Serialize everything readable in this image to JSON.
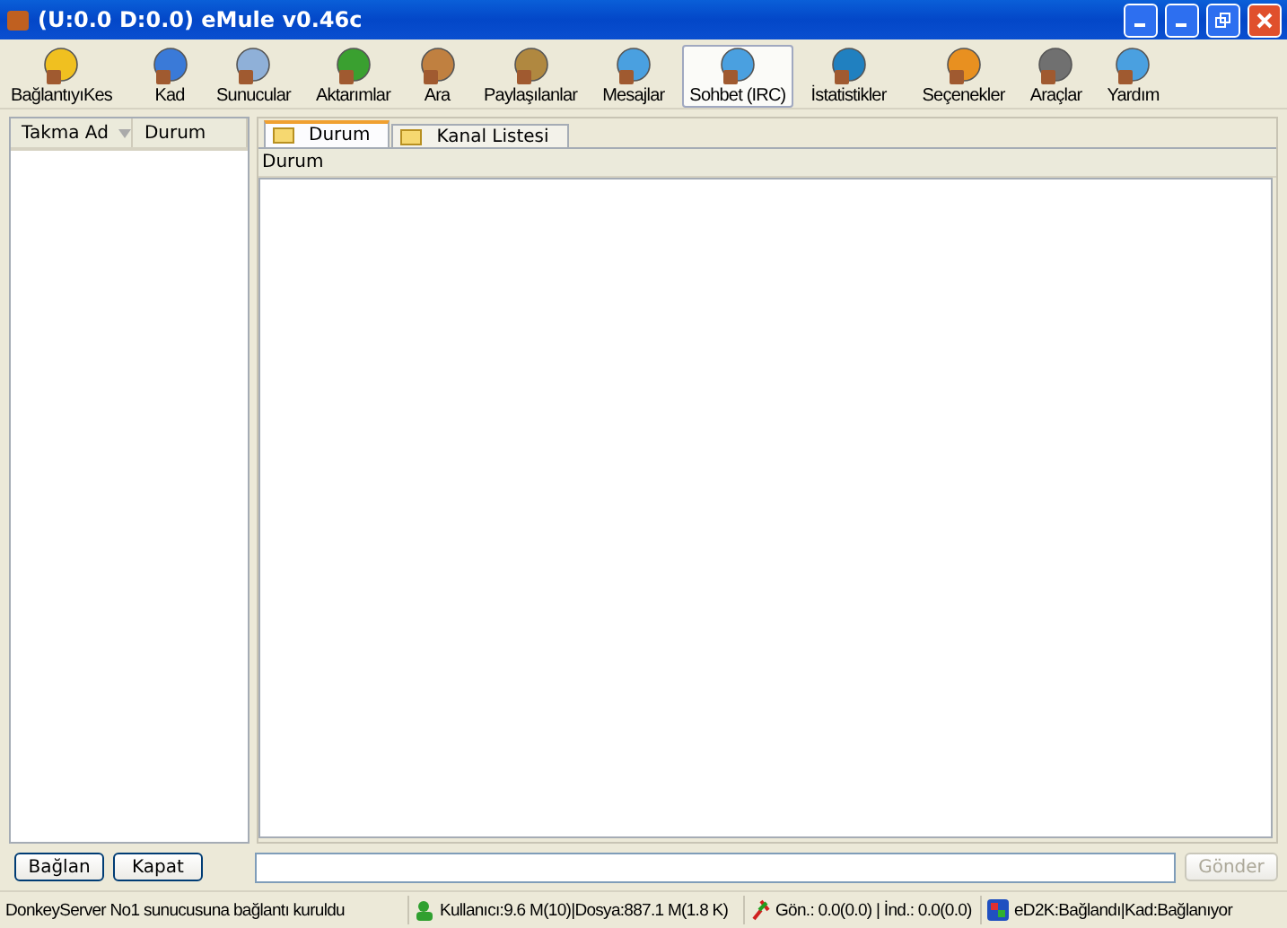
{
  "window": {
    "title": "(U:0.0 D:0.0) eMule v0.46c"
  },
  "toolbar": [
    {
      "label": "BağlantıyıKes",
      "selected": false
    },
    {
      "label": "Kad",
      "selected": false
    },
    {
      "label": "Sunucular",
      "selected": false
    },
    {
      "label": "Aktarımlar",
      "selected": false
    },
    {
      "label": "Ara",
      "selected": false
    },
    {
      "label": "Paylaşılanlar",
      "selected": false
    },
    {
      "label": "Mesajlar",
      "selected": false
    },
    {
      "label": "Sohbet (IRC)",
      "selected": true
    },
    {
      "label": "İstatistikler",
      "selected": false
    },
    {
      "label": "Seçenekler",
      "selected": false
    },
    {
      "label": "Araçlar",
      "selected": false
    },
    {
      "label": "Yardım",
      "selected": false
    }
  ],
  "nick_list": {
    "columns": [
      "Takma Ad",
      "Durum"
    ]
  },
  "tabs": [
    {
      "label": "Durum",
      "selected": true
    },
    {
      "label": "Kanal Listesi",
      "selected": false
    }
  ],
  "status_pane": {
    "column": "Durum"
  },
  "buttons": {
    "connect": "Bağlan",
    "close": "Kapat",
    "send": {
      "label": "Gönder",
      "disabled": true
    }
  },
  "status_bar": {
    "message": "DonkeyServer No1 sunucusuna bağlantı kuruldu",
    "users": "Kullanıcı:9.6 M(10)|Dosya:887.1 M(1.8 K)",
    "transfer": "Gön.: 0.0(0.0) | İnd.: 0.0(0.0)",
    "network": "eD2K:Bağlandı|Kad:Bağlanıyor"
  }
}
